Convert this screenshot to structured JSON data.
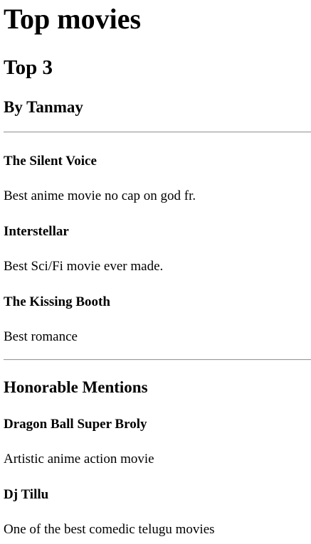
{
  "page": {
    "title": "Top movies",
    "subtitle": "Top 3",
    "author": "By Tanmay"
  },
  "top3": [
    {
      "name": "The Silent Voice",
      "description": "Best anime movie no cap on god fr."
    },
    {
      "name": "Interstellar",
      "description": "Best Sci/Fi movie ever made."
    },
    {
      "name": "The Kissing Booth",
      "description": "Best romance"
    }
  ],
  "honorable": {
    "heading": "Honorable Mentions",
    "items": [
      {
        "name": "Dragon Ball Super Broly",
        "description": "Artistic anime action movie"
      },
      {
        "name": "Dj Tillu",
        "description": "One of the best comedic telugu movies"
      }
    ]
  }
}
